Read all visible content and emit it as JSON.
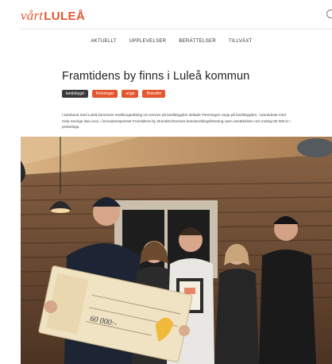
{
  "header": {
    "logo_prefix": "vårt",
    "logo_name": "LULEÅ",
    "search_icon": "search-icon"
  },
  "nav": {
    "items": [
      {
        "label": "AKTUELLT"
      },
      {
        "label": "UPPLEVELSER"
      },
      {
        "label": "BERÄTTELSER"
      },
      {
        "label": "TILLVÄXT"
      }
    ]
  },
  "article": {
    "title": "Framtidens by finns i Luleå kommun",
    "tags": [
      {
        "label": "landsbygd",
        "color": "#3a3a3a"
      },
      {
        "label": "föreningar",
        "color": "#e4572e"
      },
      {
        "label": "unga",
        "color": "#e4572e"
      },
      {
        "label": "Brandön",
        "color": "#e4572e"
      }
    ],
    "intro": "I samband med Luleå kommuns medborgardialog om service på landsbygden deltade Föreningen Unga på landsbygden, i samarbete med Hela Sverige ska Leva, i innovationsprisset Framtidens by. Brandön/Ourrans bosutvecklingsförening vann utmärkelsen och mottog 60 000 kr i prisbelöpp."
  },
  "hero": {
    "description_icon": "photo-image",
    "cheque_amount": "60 000:-",
    "colors": {
      "wall": "#6b4a33",
      "ceiling": "#c49a6c",
      "cheque": "#efe3c4"
    }
  }
}
